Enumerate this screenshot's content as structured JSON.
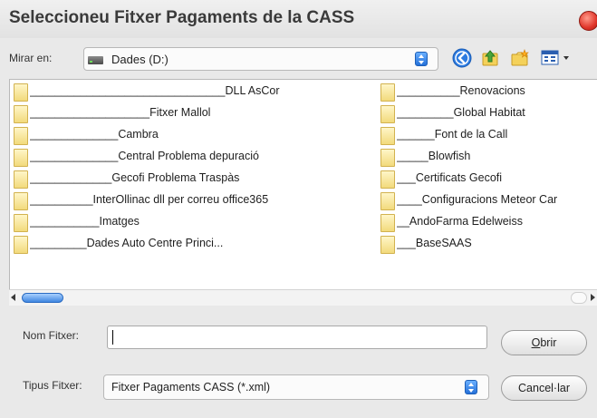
{
  "window": {
    "title": "Seleccioneu Fitxer Pagaments de la CASS"
  },
  "toolbar": {
    "look_in_label": "Mirar en:",
    "look_in_value": "Dades (D:)",
    "icons": [
      "back-icon",
      "up-folder-icon",
      "new-folder-icon",
      "view-menu-icon"
    ]
  },
  "files": {
    "left": [
      "_______________________________DLL AsCor",
      "___________________Fitxer Mallol",
      "______________Cambra",
      "______________Central Problema depuració",
      "_____________Gecofi Problema Traspàs",
      "__________InterOllinac dll per correu office365",
      "___________Imatges",
      "_________Dades Auto Centre Princi..."
    ],
    "right": [
      "__________Renovacions",
      "_________Global Habitat",
      "______Font de la Call",
      "_____Blowfish",
      "___Certificats Gecofi",
      "____Configuracions Meteor Car",
      "__AndoFarma Edelweiss",
      "___BaseSAAS"
    ]
  },
  "form": {
    "name_label": "Nom Fitxer:",
    "name_value": "",
    "type_label": "Tipus Fitxer:",
    "type_value": "Fitxer Pagaments CASS (*.xml)",
    "open_label_mnemonic": "O",
    "open_label_rest": "brir",
    "cancel_label": "Cancel·lar"
  },
  "colors": {
    "dialog_bg": "#e9e9e9",
    "folder": "#f2da7c",
    "accent_blue": "#2570d8",
    "close_red": "#e0352a"
  }
}
